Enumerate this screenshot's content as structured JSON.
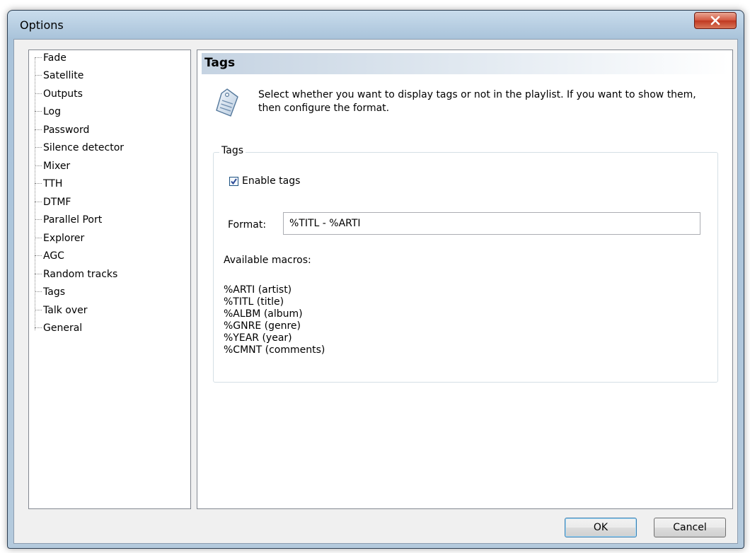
{
  "window": {
    "title": "Options",
    "close_label": "X"
  },
  "tree": {
    "items": [
      {
        "label": "Fade"
      },
      {
        "label": "Satellite"
      },
      {
        "label": "Outputs"
      },
      {
        "label": "Log"
      },
      {
        "label": "Password"
      },
      {
        "label": "Silence detector"
      },
      {
        "label": "Mixer"
      },
      {
        "label": "TTH"
      },
      {
        "label": "DTMF"
      },
      {
        "label": "Parallel Port"
      },
      {
        "label": "Explorer"
      },
      {
        "label": "AGC"
      },
      {
        "label": "Random tracks"
      },
      {
        "label": "Tags"
      },
      {
        "label": "Talk over"
      },
      {
        "label": "General"
      }
    ],
    "selected": "Tags"
  },
  "panel": {
    "title": "Tags",
    "icon": "tag-icon",
    "description": "Select whether you want to display tags or not in the playlist. If you want to show them, then configure the format.",
    "group": {
      "label": "Tags",
      "enable_tags_label": "Enable tags",
      "enable_tags_checked": true,
      "format_label": "Format:",
      "format_value": "%TITL - %ARTI",
      "macros_label": "Available macros:",
      "macros": [
        "%ARTI (artist)",
        "%TITL (title)",
        "%ALBM (album)",
        "%GNRE (genre)",
        "%YEAR (year)",
        "%CMNT (comments)"
      ]
    }
  },
  "buttons": {
    "ok_label": "OK",
    "cancel_label": "Cancel"
  },
  "colors": {
    "close_button": "#c03820",
    "header_gradient_start": "#c5d3e2"
  }
}
